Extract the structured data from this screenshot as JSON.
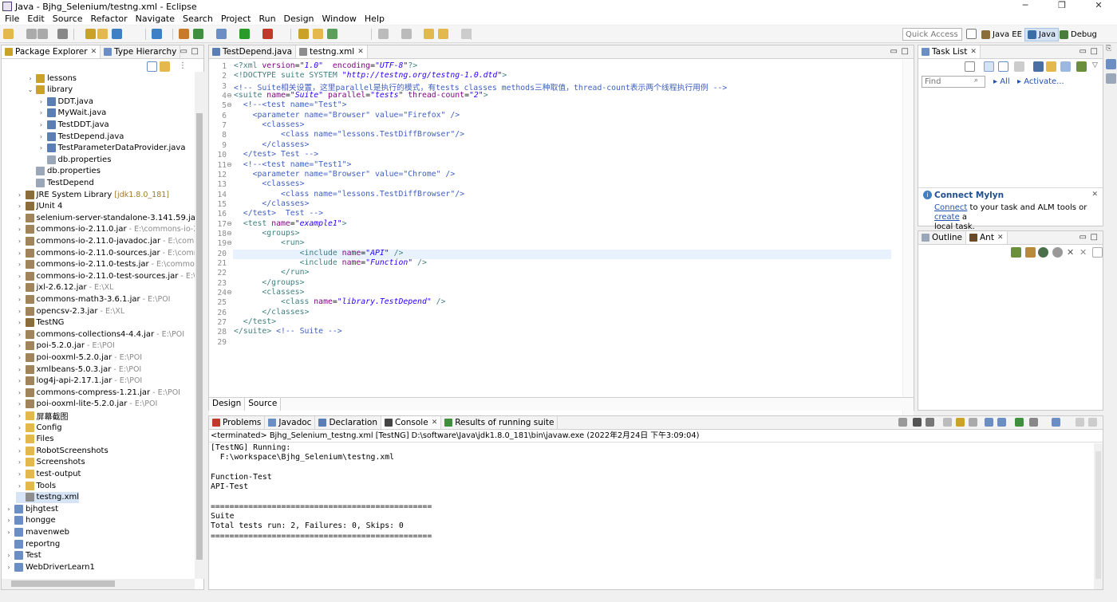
{
  "window": {
    "title": "Java - Bjhg_Selenium/testng.xml - Eclipse",
    "minimize": "─",
    "maximize": "❐",
    "close": "✕"
  },
  "menu": [
    "File",
    "Edit",
    "Source",
    "Refactor",
    "Navigate",
    "Search",
    "Project",
    "Run",
    "Design",
    "Window",
    "Help"
  ],
  "toolbar": {
    "quick_access_placeholder": "Quick Access",
    "perspectives": [
      {
        "label": "Java EE",
        "active": false,
        "color": "#8a6d3b"
      },
      {
        "label": "Java",
        "active": true,
        "color": "#3b6ea5"
      },
      {
        "label": "Debug",
        "active": false,
        "color": "#4a7d3b"
      }
    ]
  },
  "package_explorer": {
    "tabs": [
      "Package Explorer",
      "Type Hierarchy"
    ],
    "items": [
      {
        "label": "lessons",
        "annotation": "",
        "depth": 2,
        "arrow": "›",
        "icon": "package-icon",
        "color": "#c9a227"
      },
      {
        "label": "library",
        "annotation": "",
        "depth": 2,
        "arrow": "⌄",
        "icon": "package-icon",
        "color": "#c9a227"
      },
      {
        "label": "DDT.java",
        "annotation": "",
        "depth": 3,
        "arrow": "›",
        "icon": "java-file-icon",
        "color": "#5b7fb5"
      },
      {
        "label": "MyWait.java",
        "annotation": "",
        "depth": 3,
        "arrow": "›",
        "icon": "java-file-icon",
        "color": "#5b7fb5"
      },
      {
        "label": "TestDDT.java",
        "annotation": "",
        "depth": 3,
        "arrow": "›",
        "icon": "java-file-icon",
        "color": "#5b7fb5"
      },
      {
        "label": "TestDepend.java",
        "annotation": "",
        "depth": 3,
        "arrow": "›",
        "icon": "java-file-icon",
        "color": "#5b7fb5"
      },
      {
        "label": "TestParameterDataProvider.java",
        "annotation": "",
        "depth": 3,
        "arrow": "›",
        "icon": "java-file-icon",
        "color": "#5b7fb5"
      },
      {
        "label": "db.properties",
        "annotation": "",
        "depth": 3,
        "arrow": "",
        "icon": "file-icon",
        "color": "#9aa7b8"
      },
      {
        "label": "db.properties",
        "annotation": "",
        "depth": 2,
        "arrow": "",
        "icon": "file-icon",
        "color": "#9aa7b8"
      },
      {
        "label": "TestDepend",
        "annotation": "",
        "depth": 2,
        "arrow": "",
        "icon": "file-icon",
        "color": "#9aa7b8"
      },
      {
        "label": "JRE System Library",
        "annotation": "[jdk1.8.0_181]",
        "depth": 1,
        "arrow": "›",
        "icon": "library-icon",
        "color": "#8a6d3b",
        "jre": true
      },
      {
        "label": "JUnit 4",
        "annotation": "",
        "depth": 1,
        "arrow": "›",
        "icon": "library-icon",
        "color": "#8a6d3b"
      },
      {
        "label": "selenium-server-standalone-3.141.59.jar",
        "annotation": "",
        "depth": 1,
        "arrow": "›",
        "icon": "jar-icon",
        "color": "#a0845c"
      },
      {
        "label": "commons-io-2.11.0.jar",
        "annotation": "- E:\\commons-io-2.11.0",
        "depth": 1,
        "arrow": "›",
        "icon": "jar-icon",
        "color": "#a0845c"
      },
      {
        "label": "commons-io-2.11.0-javadoc.jar",
        "annotation": "- E:\\commons-",
        "depth": 1,
        "arrow": "›",
        "icon": "jar-icon",
        "color": "#a0845c"
      },
      {
        "label": "commons-io-2.11.0-sources.jar",
        "annotation": "- E:\\commons-",
        "depth": 1,
        "arrow": "›",
        "icon": "jar-icon",
        "color": "#a0845c"
      },
      {
        "label": "commons-io-2.11.0-tests.jar",
        "annotation": "- E:\\commons-io-",
        "depth": 1,
        "arrow": "›",
        "icon": "jar-icon",
        "color": "#a0845c"
      },
      {
        "label": "commons-io-2.11.0-test-sources.jar",
        "annotation": "- E:\\comm",
        "depth": 1,
        "arrow": "›",
        "icon": "jar-icon",
        "color": "#a0845c"
      },
      {
        "label": "jxl-2.6.12.jar",
        "annotation": "- E:\\XL",
        "depth": 1,
        "arrow": "›",
        "icon": "jar-icon",
        "color": "#a0845c"
      },
      {
        "label": "commons-math3-3.6.1.jar",
        "annotation": "- E:\\POI",
        "depth": 1,
        "arrow": "›",
        "icon": "jar-icon",
        "color": "#a0845c"
      },
      {
        "label": "opencsv-2.3.jar",
        "annotation": "- E:\\XL",
        "depth": 1,
        "arrow": "›",
        "icon": "jar-icon",
        "color": "#a0845c"
      },
      {
        "label": "TestNG",
        "annotation": "",
        "depth": 1,
        "arrow": "›",
        "icon": "library-icon",
        "color": "#8a6d3b"
      },
      {
        "label": "commons-collections4-4.4.jar",
        "annotation": "- E:\\POI",
        "depth": 1,
        "arrow": "›",
        "icon": "jar-icon",
        "color": "#a0845c"
      },
      {
        "label": "poi-5.2.0.jar",
        "annotation": "- E:\\POI",
        "depth": 1,
        "arrow": "›",
        "icon": "jar-icon",
        "color": "#a0845c"
      },
      {
        "label": "poi-ooxml-5.2.0.jar",
        "annotation": "- E:\\POI",
        "depth": 1,
        "arrow": "›",
        "icon": "jar-icon",
        "color": "#a0845c"
      },
      {
        "label": "xmlbeans-5.0.3.jar",
        "annotation": "- E:\\POI",
        "depth": 1,
        "arrow": "›",
        "icon": "jar-icon",
        "color": "#a0845c"
      },
      {
        "label": "log4j-api-2.17.1.jar",
        "annotation": "- E:\\POI",
        "depth": 1,
        "arrow": "›",
        "icon": "jar-icon",
        "color": "#a0845c"
      },
      {
        "label": "commons-compress-1.21.jar",
        "annotation": "- E:\\POI",
        "depth": 1,
        "arrow": "›",
        "icon": "jar-icon",
        "color": "#a0845c"
      },
      {
        "label": "poi-ooxml-lite-5.2.0.jar",
        "annotation": "- E:\\POI",
        "depth": 1,
        "arrow": "›",
        "icon": "jar-icon",
        "color": "#a0845c"
      },
      {
        "label": "屏幕截图",
        "annotation": "",
        "depth": 1,
        "arrow": "›",
        "icon": "folder-icon",
        "color": "#e3b84d"
      },
      {
        "label": "Config",
        "annotation": "",
        "depth": 1,
        "arrow": "›",
        "icon": "folder-icon",
        "color": "#e3b84d"
      },
      {
        "label": "Files",
        "annotation": "",
        "depth": 1,
        "arrow": "›",
        "icon": "folder-icon",
        "color": "#e3b84d"
      },
      {
        "label": "RobotScreenshots",
        "annotation": "",
        "depth": 1,
        "arrow": "›",
        "icon": "folder-icon",
        "color": "#e3b84d"
      },
      {
        "label": "Screenshots",
        "annotation": "",
        "depth": 1,
        "arrow": "›",
        "icon": "folder-icon",
        "color": "#e3b84d"
      },
      {
        "label": "test-output",
        "annotation": "",
        "depth": 1,
        "arrow": "›",
        "icon": "folder-icon",
        "color": "#e3b84d"
      },
      {
        "label": "Tools",
        "annotation": "",
        "depth": 1,
        "arrow": "›",
        "icon": "folder-icon",
        "color": "#e3b84d"
      },
      {
        "label": "testng.xml",
        "annotation": "",
        "depth": 1,
        "arrow": "",
        "icon": "xml-file-icon",
        "color": "#8e8e8e",
        "selected": true
      },
      {
        "label": "bjhgtest",
        "annotation": "",
        "depth": 0,
        "arrow": "›",
        "icon": "project-icon",
        "color": "#6b8fc4"
      },
      {
        "label": "hongge",
        "annotation": "",
        "depth": 0,
        "arrow": "›",
        "icon": "project-icon",
        "color": "#6b8fc4"
      },
      {
        "label": "mavenweb",
        "annotation": "",
        "depth": 0,
        "arrow": "›",
        "icon": "project-icon",
        "color": "#6b8fc4"
      },
      {
        "label": "reportng",
        "annotation": "",
        "depth": 0,
        "arrow": "",
        "icon": "project-icon",
        "color": "#6b8fc4"
      },
      {
        "label": "Test",
        "annotation": "",
        "depth": 0,
        "arrow": "›",
        "icon": "project-icon",
        "color": "#6b8fc4"
      },
      {
        "label": "WebDriverLearn1",
        "annotation": "",
        "depth": 0,
        "arrow": "›",
        "icon": "project-icon",
        "color": "#6b8fc4"
      }
    ]
  },
  "editor": {
    "tabs": [
      {
        "label": "TestDepend.java",
        "active": false,
        "icon": "java-file-icon"
      },
      {
        "label": "testng.xml",
        "active": true,
        "icon": "xml-file-icon"
      }
    ],
    "lines": [
      [
        [
          "t",
          "<?xml "
        ],
        [
          "a",
          "version"
        ],
        [
          "",
          "="
        ],
        [
          "s",
          "\"1.0\""
        ],
        [
          "",
          "",
          " "
        ],
        [
          "a",
          " encoding"
        ],
        [
          "",
          "="
        ],
        [
          "s",
          "\"UTF-8\""
        ],
        [
          "t",
          "?>"
        ]
      ],
      [
        [
          "t",
          "<!DOCTYPE suite SYSTEM "
        ],
        [
          "s",
          "\"http://testng.org/testng-1.0.dtd\""
        ],
        [
          "t",
          ">"
        ]
      ],
      [
        [
          "c",
          "<!-- Suite相关设置，这里parallel是执行的模式，有tests classes methods三种取值，thread-count表示两个线程执行用例 -->"
        ]
      ],
      [
        [
          "t",
          "<suite "
        ],
        [
          "a",
          "name"
        ],
        [
          "",
          "="
        ],
        [
          "s",
          "\"Suite\""
        ],
        [
          "a",
          " parallel"
        ],
        [
          "",
          "="
        ],
        [
          "s",
          "\"tests\""
        ],
        [
          "a",
          " thread-count"
        ],
        [
          "",
          "="
        ],
        [
          "s",
          "\"2\""
        ],
        [
          "t",
          ">"
        ]
      ],
      [
        [
          "c",
          "  <!--<test name=\"Test\">"
        ]
      ],
      [
        [
          "c",
          "    <parameter name=\"Browser\" value=\"Firefox\" />"
        ]
      ],
      [
        [
          "c",
          "      <classes>"
        ]
      ],
      [
        [
          "c",
          "          <class name=\"lessons.TestDiffBrowser\"/>"
        ]
      ],
      [
        [
          "c",
          "      </classes>"
        ]
      ],
      [
        [
          "c",
          "  </test> Test -->"
        ]
      ],
      [
        [
          "c",
          "  <!--<test name=\"Test1\">"
        ]
      ],
      [
        [
          "c",
          "    <parameter name=\"Browser\" value=\"Chrome\" />"
        ]
      ],
      [
        [
          "c",
          "      <classes>"
        ]
      ],
      [
        [
          "c",
          "          <class name=\"lessons.TestDiffBrowser\"/>"
        ]
      ],
      [
        [
          "c",
          "      </classes>"
        ]
      ],
      [
        [
          "c",
          "  </test>  Test -->"
        ]
      ],
      [
        [
          "t",
          "  <test "
        ],
        [
          "a",
          "name"
        ],
        [
          "",
          "="
        ],
        [
          "s",
          "\"example1\""
        ],
        [
          "t",
          ">"
        ]
      ],
      [
        [
          "t",
          "      <groups>"
        ]
      ],
      [
        [
          "t",
          "          <run>"
        ]
      ],
      [
        [
          "t",
          "              <include "
        ],
        [
          "a",
          "name"
        ],
        [
          "",
          "="
        ],
        [
          "s",
          "\"API\""
        ],
        [
          "t",
          " />"
        ]
      ],
      [
        [
          "t",
          "              <include "
        ],
        [
          "a",
          "name"
        ],
        [
          "",
          "="
        ],
        [
          "s",
          "\"Function\""
        ],
        [
          "t",
          " />"
        ]
      ],
      [
        [
          "t",
          "          </run>"
        ]
      ],
      [
        [
          "t",
          "      </groups>"
        ]
      ],
      [
        [
          "t",
          "      <classes>"
        ]
      ],
      [
        [
          "t",
          "          <class "
        ],
        [
          "a",
          "name"
        ],
        [
          "",
          "="
        ],
        [
          "s",
          "\"library.TestDepend\""
        ],
        [
          "t",
          " />"
        ]
      ],
      [
        [
          "t",
          "      </classes>"
        ]
      ],
      [
        [
          "t",
          "  </test>"
        ]
      ],
      [
        [
          "t",
          "</suite>"
        ],
        [
          "c",
          " <!-- Suite -->"
        ]
      ],
      [
        [
          "",
          ""
        ]
      ]
    ],
    "line_numbers": [
      "1",
      "2",
      "3",
      "4",
      "5",
      "6",
      "7",
      "8",
      "9",
      "10",
      "11",
      "12",
      "13",
      "14",
      "15",
      "16",
      "17",
      "18",
      "19",
      "20",
      "21",
      "22",
      "23",
      "24",
      "25",
      "26",
      "27",
      "28",
      "29"
    ],
    "bottom_tabs": [
      "Design",
      "Source"
    ]
  },
  "task_list": {
    "tab": "Task List",
    "find_placeholder": "Find",
    "all_label": "All",
    "activate_label": "Activate...",
    "mylyn_title": "Connect Mylyn",
    "mylyn_connect": "Connect",
    "mylyn_text1": " to your task and ALM tools or ",
    "mylyn_create": "create",
    "mylyn_text2": " a",
    "mylyn_text3": "local task."
  },
  "outline": {
    "tabs": [
      "Outline",
      "Ant"
    ]
  },
  "console": {
    "tabs": [
      "Problems",
      "Javadoc",
      "Declaration",
      "Console",
      "Results of running suite"
    ],
    "status": "<terminated> Bjhg_Selenium_testng.xml [TestNG] D:\\software\\Java\\jdk1.8.0_181\\bin\\javaw.exe (2022年2月24日 下午3:09:04)",
    "output": "[TestNG] Running:\n  F:\\workspace\\Bjhg_Selenium\\testng.xml\n\nFunction-Test\nAPI-Test\n\n===============================================\nSuite\nTotal tests run: 2, Failures: 0, Skips: 0\n==============================================="
  },
  "colors": {
    "selection": "#d7e4f5",
    "highlight_line": "#e8f2fe",
    "tag": "#3f7f7f",
    "attr": "#7f007f",
    "string": "#2a00ff",
    "comment": "#3f5fbf"
  }
}
